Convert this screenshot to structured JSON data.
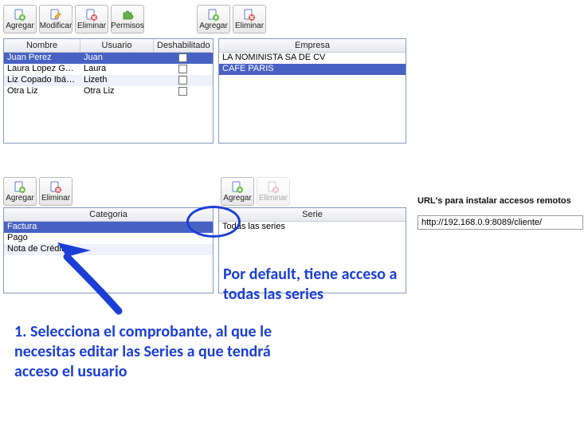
{
  "toolbar_top": {
    "agregar": "Agregar",
    "modificar": "Modificar",
    "eliminar": "Eliminar",
    "permisos": "Permisos",
    "agregar2": "Agregar",
    "eliminar2": "Eliminar"
  },
  "users_grid": {
    "headers": {
      "nombre": "Nombre",
      "usuario": "Usuario",
      "deshab": "Deshabilitado"
    },
    "rows": [
      {
        "nombre": "Juan Perez",
        "usuario": "Juan",
        "deshab": false,
        "selected": true
      },
      {
        "nombre": "Laura Lopez Gó...",
        "usuario": "Laura",
        "deshab": false,
        "selected": false
      },
      {
        "nombre": "Liz Copado Ibáñez",
        "usuario": "Lizeth",
        "deshab": false,
        "selected": false
      },
      {
        "nombre": "Otra Liz",
        "usuario": "Otra Liz",
        "deshab": false,
        "selected": false
      }
    ]
  },
  "empresa_grid": {
    "header": "Empresa",
    "rows": [
      {
        "label": "LA NOMINISTA SA DE CV",
        "selected": false
      },
      {
        "label": "CAFE PARIS",
        "selected": true
      }
    ]
  },
  "toolbar_mid_left": {
    "agregar": "Agregar",
    "eliminar": "Eliminar"
  },
  "toolbar_mid_right": {
    "agregar": "Agregar",
    "eliminar": "Eliminar"
  },
  "categoria_grid": {
    "header": "Categoria",
    "rows": [
      {
        "label": "Factura",
        "selected": true
      },
      {
        "label": "Pago",
        "selected": false
      },
      {
        "label": "Nota de Crédito",
        "selected": false
      }
    ]
  },
  "serie_grid": {
    "header": "Serie",
    "rows": [
      {
        "label": "Todas las series",
        "selected": false
      }
    ]
  },
  "url_section": {
    "title": "URL's para instalar accesos remotos",
    "value": "http://192.168.0.9:8089/cliente/"
  },
  "annotations": {
    "note": "Por default, tiene acceso a todas las series",
    "step": "1. Selecciona el comprobante, al que le necesitas editar las Series a que tendrá acceso el usuario"
  }
}
